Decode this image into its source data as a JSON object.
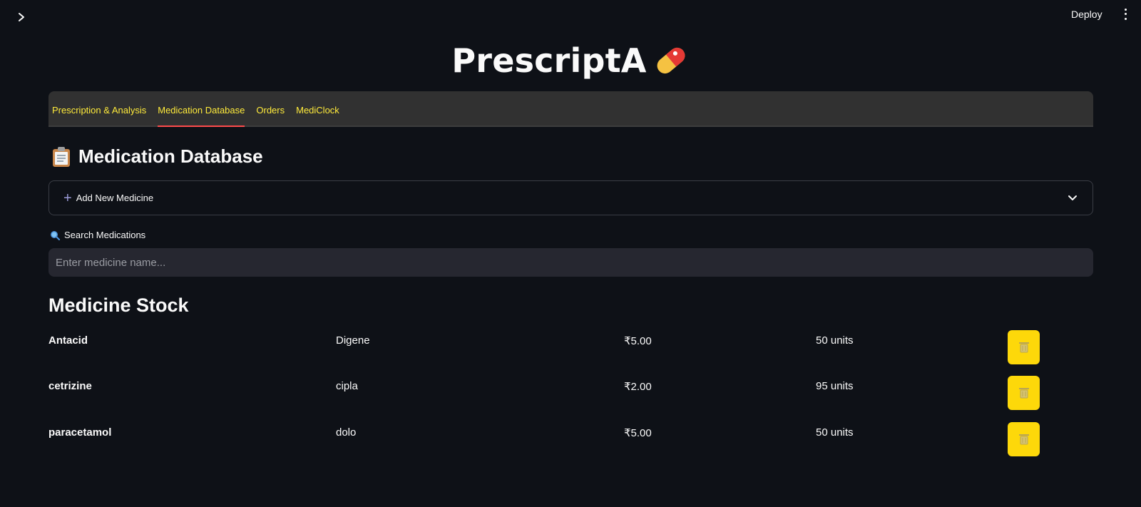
{
  "header": {
    "deploy_label": "Deploy",
    "app_title": "PrescriptA"
  },
  "tabs": [
    {
      "label": "Prescription & Analysis",
      "active": false
    },
    {
      "label": "Medication Database",
      "active": true
    },
    {
      "label": "Orders",
      "active": false
    },
    {
      "label": "MediClock",
      "active": false
    }
  ],
  "section": {
    "title": "Medication Database",
    "title_icon": "clipboard-icon"
  },
  "expander": {
    "label": "Add New Medicine",
    "icon": "plus-icon"
  },
  "search": {
    "label": "Search Medications",
    "icon": "magnifier-icon",
    "placeholder": "Enter medicine name...",
    "value": ""
  },
  "stock": {
    "title": "Medicine Stock",
    "rows": [
      {
        "name": "Antacid",
        "brand": "Digene",
        "price": "₹5.00",
        "quantity": "50 units"
      },
      {
        "name": "cetrizine",
        "brand": "cipla",
        "price": "₹2.00",
        "quantity": "95 units"
      },
      {
        "name": "paracetamol",
        "brand": "dolo",
        "price": "₹5.00",
        "quantity": "50 units"
      }
    ],
    "action_icon": "trash-icon"
  },
  "colors": {
    "background": "#0e1117",
    "tab_text": "#ffeb3b",
    "tab_active_underline": "#ff4b4b",
    "action_button": "#fdd80a",
    "input_background": "#262730"
  }
}
